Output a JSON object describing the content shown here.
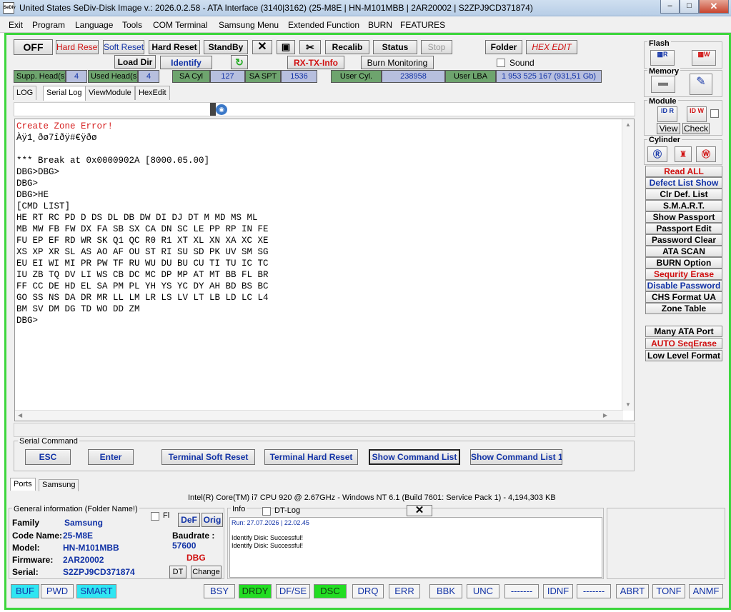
{
  "window": {
    "app_icon_text": "SeDiv",
    "title": "United States  SeDiv-Disk Image v.: 2026.0.2.58 - ATA Interface (3140|3162)  (25-M8E | HN-M101MBB | 2AR20002 | S2ZPJ9CD371874)",
    "minimize": "–",
    "maximize": "□",
    "close": "✕"
  },
  "menu": [
    "Exit",
    "Program",
    "Language",
    "Tools",
    "COM Terminal",
    "Samsung Menu",
    "Extended Function",
    "BURN",
    "FEATURES"
  ],
  "toolbar": {
    "off": "OFF",
    "hard_reset_small": "Hard Reset",
    "soft_reset": "Soft Reset",
    "hard_reset": "Hard Reset",
    "standby": "StandBy",
    "recalib": "Recalib",
    "status": "Status",
    "stop": "Stop",
    "folder": "Folder",
    "hex_edit": "HEX EDIT",
    "load_dir": "Load Dir",
    "identify": "Identify",
    "rx_tx_info": "RX-TX-Info",
    "burn_monitoring": "Burn Monitoring",
    "sound": "Sound"
  },
  "drive_params": [
    {
      "label": "Supp. Head(s)",
      "value": "4"
    },
    {
      "label": "Used Head(s)",
      "value": "4"
    },
    {
      "label": "SA Cyl",
      "value": "127"
    },
    {
      "label": "SA SPT",
      "value": "1536"
    },
    {
      "label": "User Cyl.",
      "value": "238958"
    },
    {
      "label": "User LBA",
      "value": "1 953 525 167  (931,51 Gb)"
    }
  ],
  "tabs": [
    "LOG",
    "Serial Log",
    "ViewModule",
    "HexEdit"
  ],
  "log": [
    {
      "text": "Create Zone Error!",
      "color": "red"
    },
    {
      "text": "Àÿ1¸ðø7îðÿ#€ÿðø",
      "color": "black"
    },
    {
      "text": "",
      "color": "black"
    },
    {
      "text": "*** Break at 0x0000902A [8000.05.00]",
      "color": "black"
    },
    {
      "text": "DBG>DBG>",
      "color": "black"
    },
    {
      "text": "DBG>",
      "color": "black"
    },
    {
      "text": "DBG>HE",
      "color": "black"
    },
    {
      "text": "[CMD LIST]",
      "color": "black"
    },
    {
      "text": "HE RT RC PD D DS DL DB DW DI DJ DT M MD MS ML",
      "color": "black"
    },
    {
      "text": "MB MW FB FW DX FA SB SX CA DN SC LE PP RP IN FE",
      "color": "black"
    },
    {
      "text": "FU EP EF RD WR SK Q1 QC R0 R1 XT XL XN XA XC XE",
      "color": "black"
    },
    {
      "text": "XS XP XR SL AS AO AF OU ST RI SU SD PK UV SM SG",
      "color": "black"
    },
    {
      "text": "EU EI WI MI PR PW TF RU WU DU BU CU TI TU IC TC",
      "color": "black"
    },
    {
      "text": "IU ZB TQ DV LI WS CB DC MC DP MP AT MT BB FL BR",
      "color": "black"
    },
    {
      "text": "FF CC DE HD EL SA PM PL YH YS YC DY AH BD BS BC",
      "color": "black"
    },
    {
      "text": "GO SS NS DA DR MR LL LM LR LS LV LT LB LD LC L4",
      "color": "black"
    },
    {
      "text": "BM SV DM DG TD WO DD ZM",
      "color": "black"
    },
    {
      "text": "DBG>",
      "color": "black"
    }
  ],
  "serial_command": {
    "group_label": "Serial Command",
    "esc": "ESC",
    "enter": "Enter",
    "terminal_soft_reset": "Terminal Soft Reset",
    "terminal_hard_reset": "Terminal Hard Reset",
    "show_command_list": "Show Command List",
    "show_command_list_1": "Show Command List 1"
  },
  "bottom_tabs": [
    "Ports",
    "Samsung"
  ],
  "system_info": "Intel(R) Core(TM) i7 CPU 920  @ 2.67GHz - Windows NT 6.1 (Build 7601: Service Pack 1) -  4,194,303 KB",
  "general_info": {
    "group_label": "General information (Folder Name!)",
    "fl_label": "Fl",
    "def_btn": "DeF",
    "orig_btn": "Orig",
    "family_label": "Family",
    "family": "Samsung",
    "code_name_label": "Code Name:",
    "code_name": "25-M8E",
    "model_label": "Model:",
    "model": "HN-M101MBB",
    "firmware_label": "Firmware:",
    "firmware": "2AR20002",
    "serial_label": "Serial:",
    "serial": "S2ZPJ9CD371874",
    "baudrate_label": "Baudrate :",
    "baudrate": "57600",
    "dbg": "DBG",
    "dt_btn": "DT",
    "change_btn": "Change"
  },
  "info_panel": {
    "label": "Info",
    "dt_log": "DT-Log",
    "run": "Run: 27.07.2026  |  22.02.45",
    "lines": [
      "Identify Disk: Successful!",
      "Identify Disk: Successful!"
    ]
  },
  "side": {
    "flash": "Flash",
    "memory": "Memory",
    "module": "Module",
    "view": "View",
    "check": "Check",
    "cylinder": "Cylinder",
    "id_r": "ID R",
    "id_w": "ID W",
    "buttons": [
      {
        "label": "Read ALL",
        "color": "red"
      },
      {
        "label": "Defect List Show",
        "color": "blue"
      },
      {
        "label": "Clr Def. List",
        "color": "black"
      },
      {
        "label": "S.M.A.R.T.",
        "color": "black"
      },
      {
        "label": "Show Passport",
        "color": "black"
      },
      {
        "label": "Passport Edit",
        "color": "black"
      },
      {
        "label": "Password Clear",
        "color": "black"
      },
      {
        "label": "ATA SCAN",
        "color": "black"
      },
      {
        "label": "BURN Option",
        "color": "black"
      },
      {
        "label": "Sequrity Erase",
        "color": "red"
      },
      {
        "label": "Disable Password",
        "color": "blue"
      },
      {
        "label": "CHS Format UA",
        "color": "black"
      },
      {
        "label": "Zone Table",
        "color": "black"
      }
    ],
    "buttons2": [
      {
        "label": "Many ATA Port",
        "color": "black"
      },
      {
        "label": "AUTO SeqErase",
        "color": "red"
      },
      {
        "label": "Low Level Format",
        "color": "black"
      }
    ]
  },
  "status_bar": [
    {
      "label": "BUF",
      "state": "cyan"
    },
    {
      "label": "PWD",
      "state": "off"
    },
    {
      "label": "SMART",
      "state": "cyan"
    },
    {
      "label": "BSY",
      "state": "off"
    },
    {
      "label": "DRDY",
      "state": "green"
    },
    {
      "label": "DF/SE",
      "state": "off"
    },
    {
      "label": "DSC",
      "state": "green"
    },
    {
      "label": "DRQ",
      "state": "off"
    },
    {
      "label": "ERR",
      "state": "off"
    },
    {
      "label": "BBK",
      "state": "off"
    },
    {
      "label": "UNC",
      "state": "off"
    },
    {
      "label": "-------",
      "state": "off"
    },
    {
      "label": "IDNF",
      "state": "off"
    },
    {
      "label": "-------",
      "state": "off"
    },
    {
      "label": "ABRT",
      "state": "off"
    },
    {
      "label": "TONF",
      "state": "off"
    },
    {
      "label": "ANMF",
      "state": "off"
    }
  ]
}
